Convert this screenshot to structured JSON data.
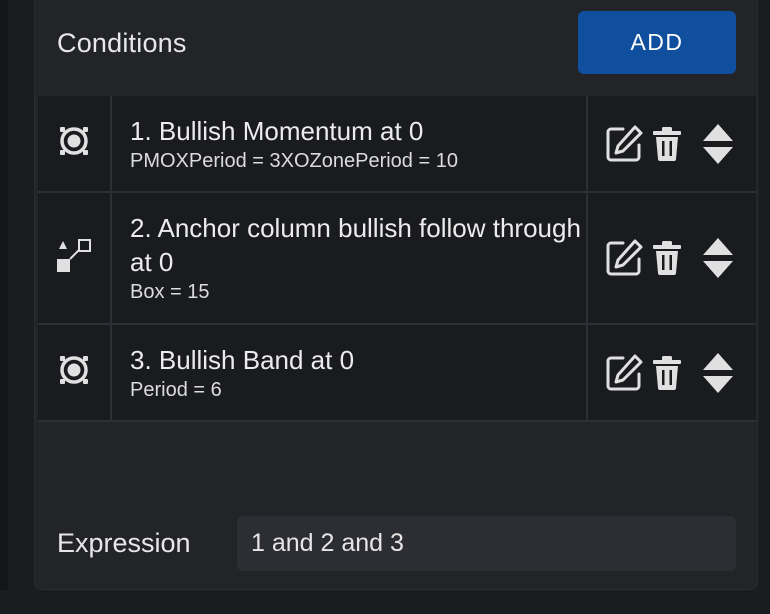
{
  "panel": {
    "title": "Conditions",
    "add_label": "ADD"
  },
  "conditions": [
    {
      "icon": "target-icon",
      "title": "1. Bullish Momentum at 0",
      "params": "PMOXPeriod = 3XOZonePeriod = 10"
    },
    {
      "icon": "pattern-path-icon",
      "title": "2. Anchor column bullish follow through at 0",
      "params": "Box = 15"
    },
    {
      "icon": "target-icon",
      "title": "3. Bullish Band at 0",
      "params": "Period = 6"
    }
  ],
  "expression": {
    "label": "Expression",
    "value": "1 and 2 and 3"
  },
  "colors": {
    "accent": "#0f4f9e",
    "panel_bg": "#232428",
    "row_bg": "#1a1b1e"
  }
}
